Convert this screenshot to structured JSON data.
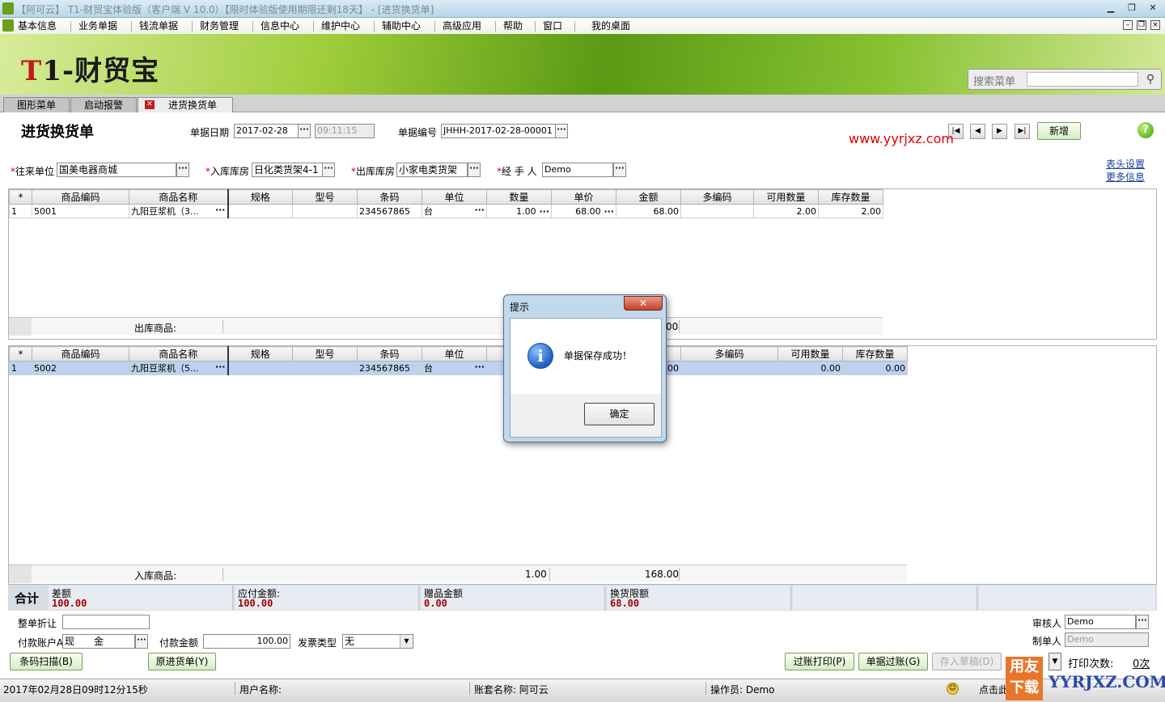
{
  "window": {
    "title": "【阿可云】 T1-财贸宝体验版（客户端 V 10.0）【限时体验版使用期限还剩18天】 - [进货换货单]"
  },
  "menu": [
    "基本信息",
    "业务单据",
    "钱流单据",
    "财务管理",
    "信息中心",
    "维护中心",
    "辅助中心",
    "高级应用",
    "帮助",
    "窗口",
    "我的桌面"
  ],
  "brand": {
    "logo_t": "T",
    "logo_rest": "1-财贸宝"
  },
  "search": {
    "label": "搜索菜单",
    "value": ""
  },
  "tabs": [
    "图形菜单",
    "启动报警",
    "进货换货单"
  ],
  "form": {
    "title": "进货换货单",
    "date_label": "单据日期",
    "date": "2017-02-28",
    "time": "09:11:15",
    "no_label": "单据编号",
    "no": "JHHH-2017-02-28-00001",
    "new_label": "新增",
    "watermark": "www.yyrjxz.com",
    "header_settings": "表头设置",
    "more_info": "更多信息",
    "partner_label": "往来单位",
    "partner": "国美电器商城",
    "in_wh_label": "入库库房",
    "in_wh": "日化类货架4-1",
    "out_wh_label": "出库库房",
    "out_wh": "小家电类货架",
    "handler_label": "经 手 人",
    "handler": "Demo"
  },
  "out_grid": {
    "columns": [
      "*",
      "商品编码",
      "商品名称",
      "规格",
      "型号",
      "条码",
      "单位",
      "数量",
      "单价",
      "金额",
      "多编码",
      "可用数量",
      "库存数量"
    ],
    "rows": [
      {
        "no": "1",
        "code": "5001",
        "name": "九阳豆浆机（3...",
        "spec": "",
        "model": "",
        "barcode": "234567865",
        "unit": "台",
        "qty": "1.00",
        "price": "68.00",
        "amount": "68.00",
        "multi": "",
        "avail": "2.00",
        "stock": "2.00"
      }
    ],
    "sum_label": "出库商品:",
    "sum_tail": "00"
  },
  "in_grid": {
    "columns": [
      "*",
      "商品编码",
      "商品名称",
      "规格",
      "型号",
      "条码",
      "单位",
      "",
      "",
      "",
      "多编码",
      "可用数量",
      "库存数量"
    ],
    "rows": [
      {
        "no": "1",
        "code": "5002",
        "name": "九阳豆浆机（5...",
        "spec": "",
        "model": "",
        "barcode": "234567865",
        "unit": "台",
        "qty": "",
        "price": "",
        "amount": "00",
        "multi": "",
        "avail": "0.00",
        "stock": "0.00"
      }
    ],
    "sum_label": "入库商品:",
    "sum_qty": "1.00",
    "sum_amount": "168.00"
  },
  "totals": {
    "label": "合计",
    "diff_label": "差额",
    "diff": "100.00",
    "payable_label": "应付金额:",
    "payable": "100.00",
    "gift_label": "赠品金额",
    "gift": "0.00",
    "limit_label": "换货限额",
    "limit": "68.00"
  },
  "footer": {
    "discount_label": "整单折让",
    "discount": "",
    "pay_account_label": "付款账户A",
    "pay_account": "现　　金",
    "pay_amount_label": "付款金额",
    "pay_amount": "100.00",
    "invoice_label": "发票类型",
    "invoice": "无",
    "auditor_label": "审核人",
    "auditor": "Demo",
    "maker_label": "制单人",
    "maker": "Demo",
    "btn_scan": "条码扫描(B)",
    "btn_orig": "原进货单(Y)",
    "btn_print_post": "过账打印(P)",
    "btn_post": "单据过账(G)",
    "btn_draft": "存入草稿(D)",
    "print_count_label": "打印次数:",
    "print_count": "0次"
  },
  "status": {
    "date": "2017年02月28日",
    "time": "09时12分15秒",
    "user": "用户名称:",
    "account": "账套名称: 阿可云",
    "operator": "操作员: Demo",
    "hint": "点击此"
  },
  "dialog": {
    "title": "提示",
    "message": "单据保存成功！",
    "ok": "确定"
  },
  "ad": {
    "block": "用友下载",
    "text": "YYRJXZ.COM"
  }
}
